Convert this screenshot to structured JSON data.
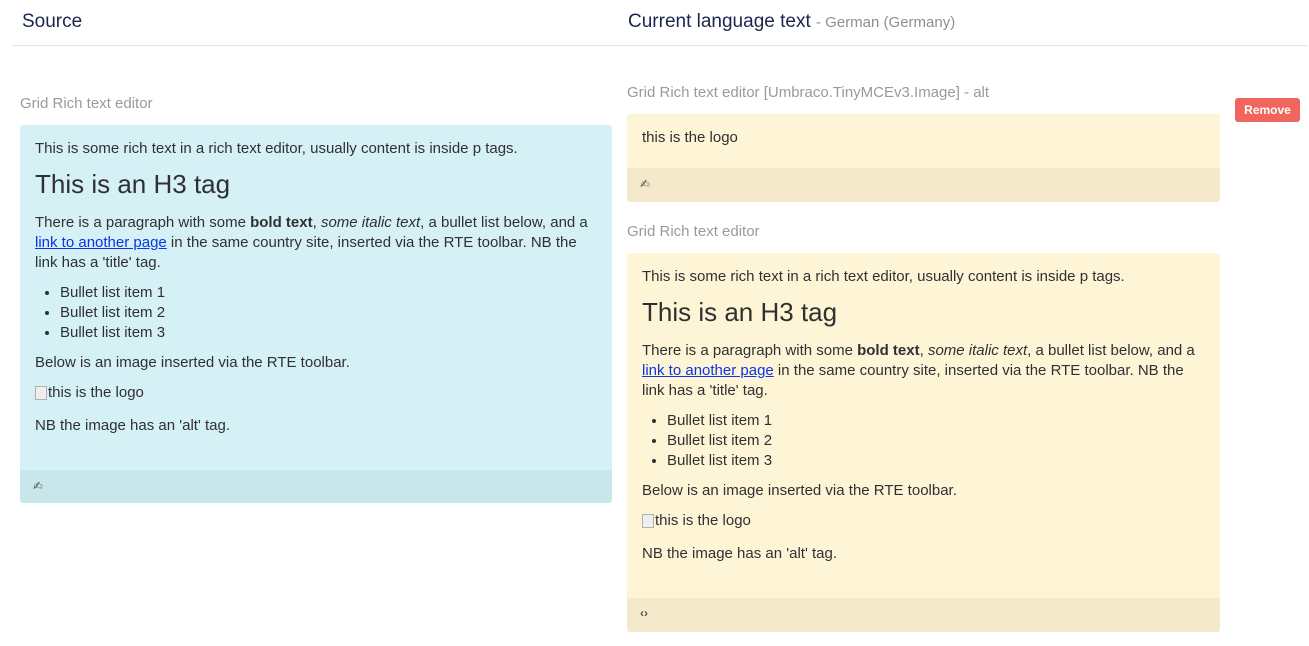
{
  "header": {
    "source_title": "Source",
    "current_title": "Current language text",
    "current_language": "- German (Germany)"
  },
  "source": {
    "label": "Grid Rich text editor",
    "rte": {
      "p1": "This is some rich text in a rich text editor, usually content is inside p tags.",
      "h3": "This is an H3 tag",
      "p2_a": "There is a paragraph with some ",
      "p2_bold": "bold text",
      "p2_b": ", ",
      "p2_italic": "some italic text",
      "p2_c": ", a bullet list below, and a ",
      "p2_link": "link to another page",
      "p2_d": " in the same country site, inserted via the RTE toolbar.  NB the link has a 'title' tag.",
      "bullets": [
        "Bullet list item 1",
        "Bullet list item 2",
        "Bullet list item 3"
      ],
      "p3": "Below is an image inserted via the RTE toolbar.",
      "img_alt": "this is the logo",
      "p4": "NB the image has an 'alt' tag."
    },
    "footer_icon": "edit-icon"
  },
  "target": {
    "alt_label": "Grid Rich text editor [Umbraco.TinyMCEv3.Image] - alt",
    "alt_value": "this is the logo",
    "alt_footer_icon": "edit-icon",
    "remove_label": "Remove",
    "rte_label": "Grid Rich text editor",
    "rte": {
      "p1": "This is some rich text in a rich text editor, usually content is inside p tags.",
      "h3": "This is an H3 tag",
      "p2_a": "There is a paragraph with some ",
      "p2_bold": "bold text",
      "p2_b": ", ",
      "p2_italic": "some italic text",
      "p2_c": ", a bullet list below, and a ",
      "p2_link": "link to another page",
      "p2_d": " in the same country site, inserted via the RTE toolbar.  NB the link has a 'title' tag.",
      "bullets": [
        "Bullet list item 1",
        "Bullet list item 2",
        "Bullet list item 3"
      ],
      "p3": "Below is an image inserted via the RTE toolbar.",
      "img_alt": "this is the logo",
      "p4": "NB the image has an 'alt' tag."
    },
    "rte_footer_icon": "code-icon",
    "rte_footer_symbol": "‹›"
  },
  "colors": {
    "source_bg": "#d5f1f6",
    "target_bg": "#fef5d6",
    "remove_bg": "#f0665f",
    "link": "#0a35e0"
  }
}
